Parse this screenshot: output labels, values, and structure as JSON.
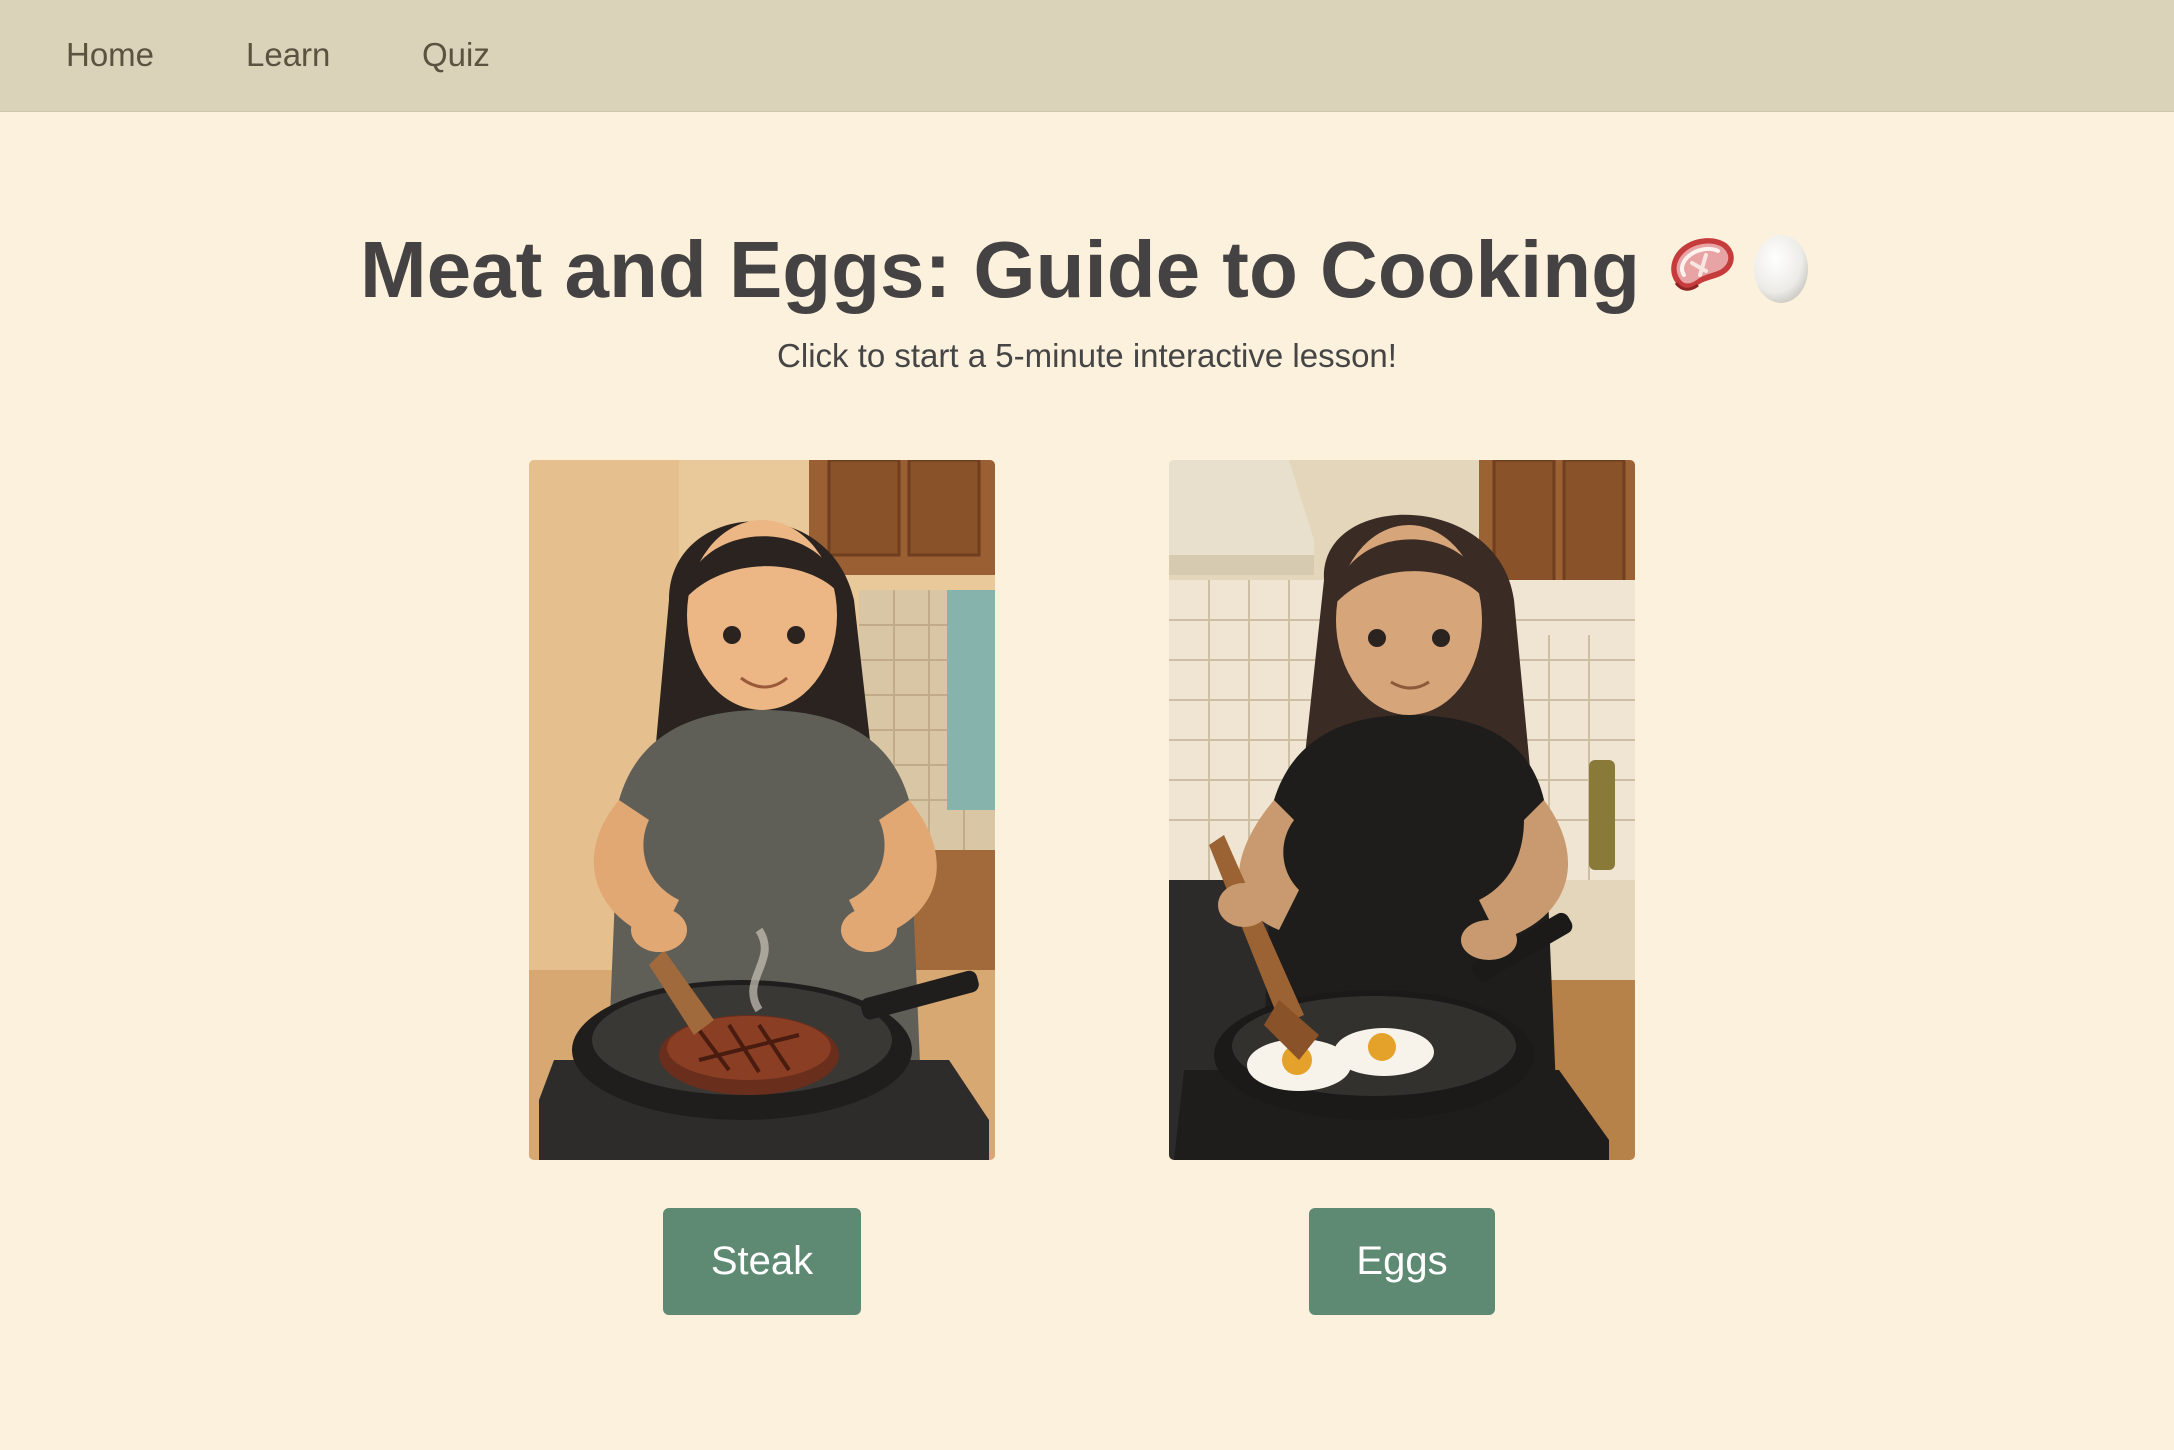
{
  "nav": {
    "items": [
      {
        "label": "Home"
      },
      {
        "label": "Learn"
      },
      {
        "label": "Quiz"
      }
    ]
  },
  "hero": {
    "title": "Meat and Eggs: Guide to Cooking",
    "title_emojis": [
      "steak-icon",
      "egg-icon"
    ],
    "subtitle": "Click to start a 5-minute interactive lesson!"
  },
  "lessons": [
    {
      "label": "Steak",
      "image": "girl-cooking-steak-illustration"
    },
    {
      "label": "Eggs",
      "image": "girl-cooking-eggs-illustration"
    }
  ],
  "colors": {
    "nav_background": "#dad3b9",
    "page_background": "#fcf1dd",
    "button_background": "#5e8a73",
    "title_text": "#444242"
  }
}
